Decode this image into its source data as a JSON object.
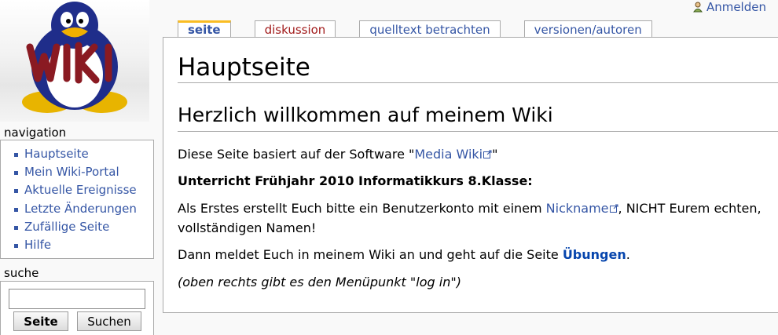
{
  "personal": {
    "login_label": "Anmelden"
  },
  "logo": {
    "text": "WIKI"
  },
  "tabs": [
    {
      "label": "seite",
      "state": "selected"
    },
    {
      "label": "diskussion",
      "state": "new"
    },
    {
      "label": "quelltext betrachten",
      "state": "normal"
    },
    {
      "label": "versionen/autoren",
      "state": "normal"
    }
  ],
  "content": {
    "title": "Hauptseite",
    "heading": "Herzlich willkommen auf meinem Wiki",
    "p1_prefix": "Diese Seite basiert auf der Software \"",
    "p1_link": "Media Wiki",
    "p1_suffix": "\"",
    "p2_bold": "Unterricht Frühjahr 2010 Informatikkurs 8.Klasse:",
    "p3_prefix": "Als Erstes erstellt Euch bitte ein Benutzerkonto mit einem ",
    "p3_link": "Nickname",
    "p3_suffix": ", NICHT Eurem echten, vollständigen Namen!",
    "p4_prefix": "Dann meldet Euch in meinem Wiki an und geht auf die Seite ",
    "p4_link": "Übungen",
    "p4_suffix": ".",
    "p5_italic": "(oben rechts gibt es den Menüpunkt \"log in\")"
  },
  "navigation": {
    "title": "navigation",
    "items": [
      "Hauptseite",
      "Mein Wiki-Portal",
      "Aktuelle Ereignisse",
      "Letzte Änderungen",
      "Zufällige Seite",
      "Hilfe"
    ]
  },
  "search": {
    "title": "suche",
    "input_value": "",
    "go_label": "Seite",
    "search_label": "Suchen"
  },
  "colors": {
    "link": "#3556a5",
    "new_link": "#a11b1b",
    "tab_selected_accent": "#fabd23",
    "border": "#aaaaaa"
  }
}
